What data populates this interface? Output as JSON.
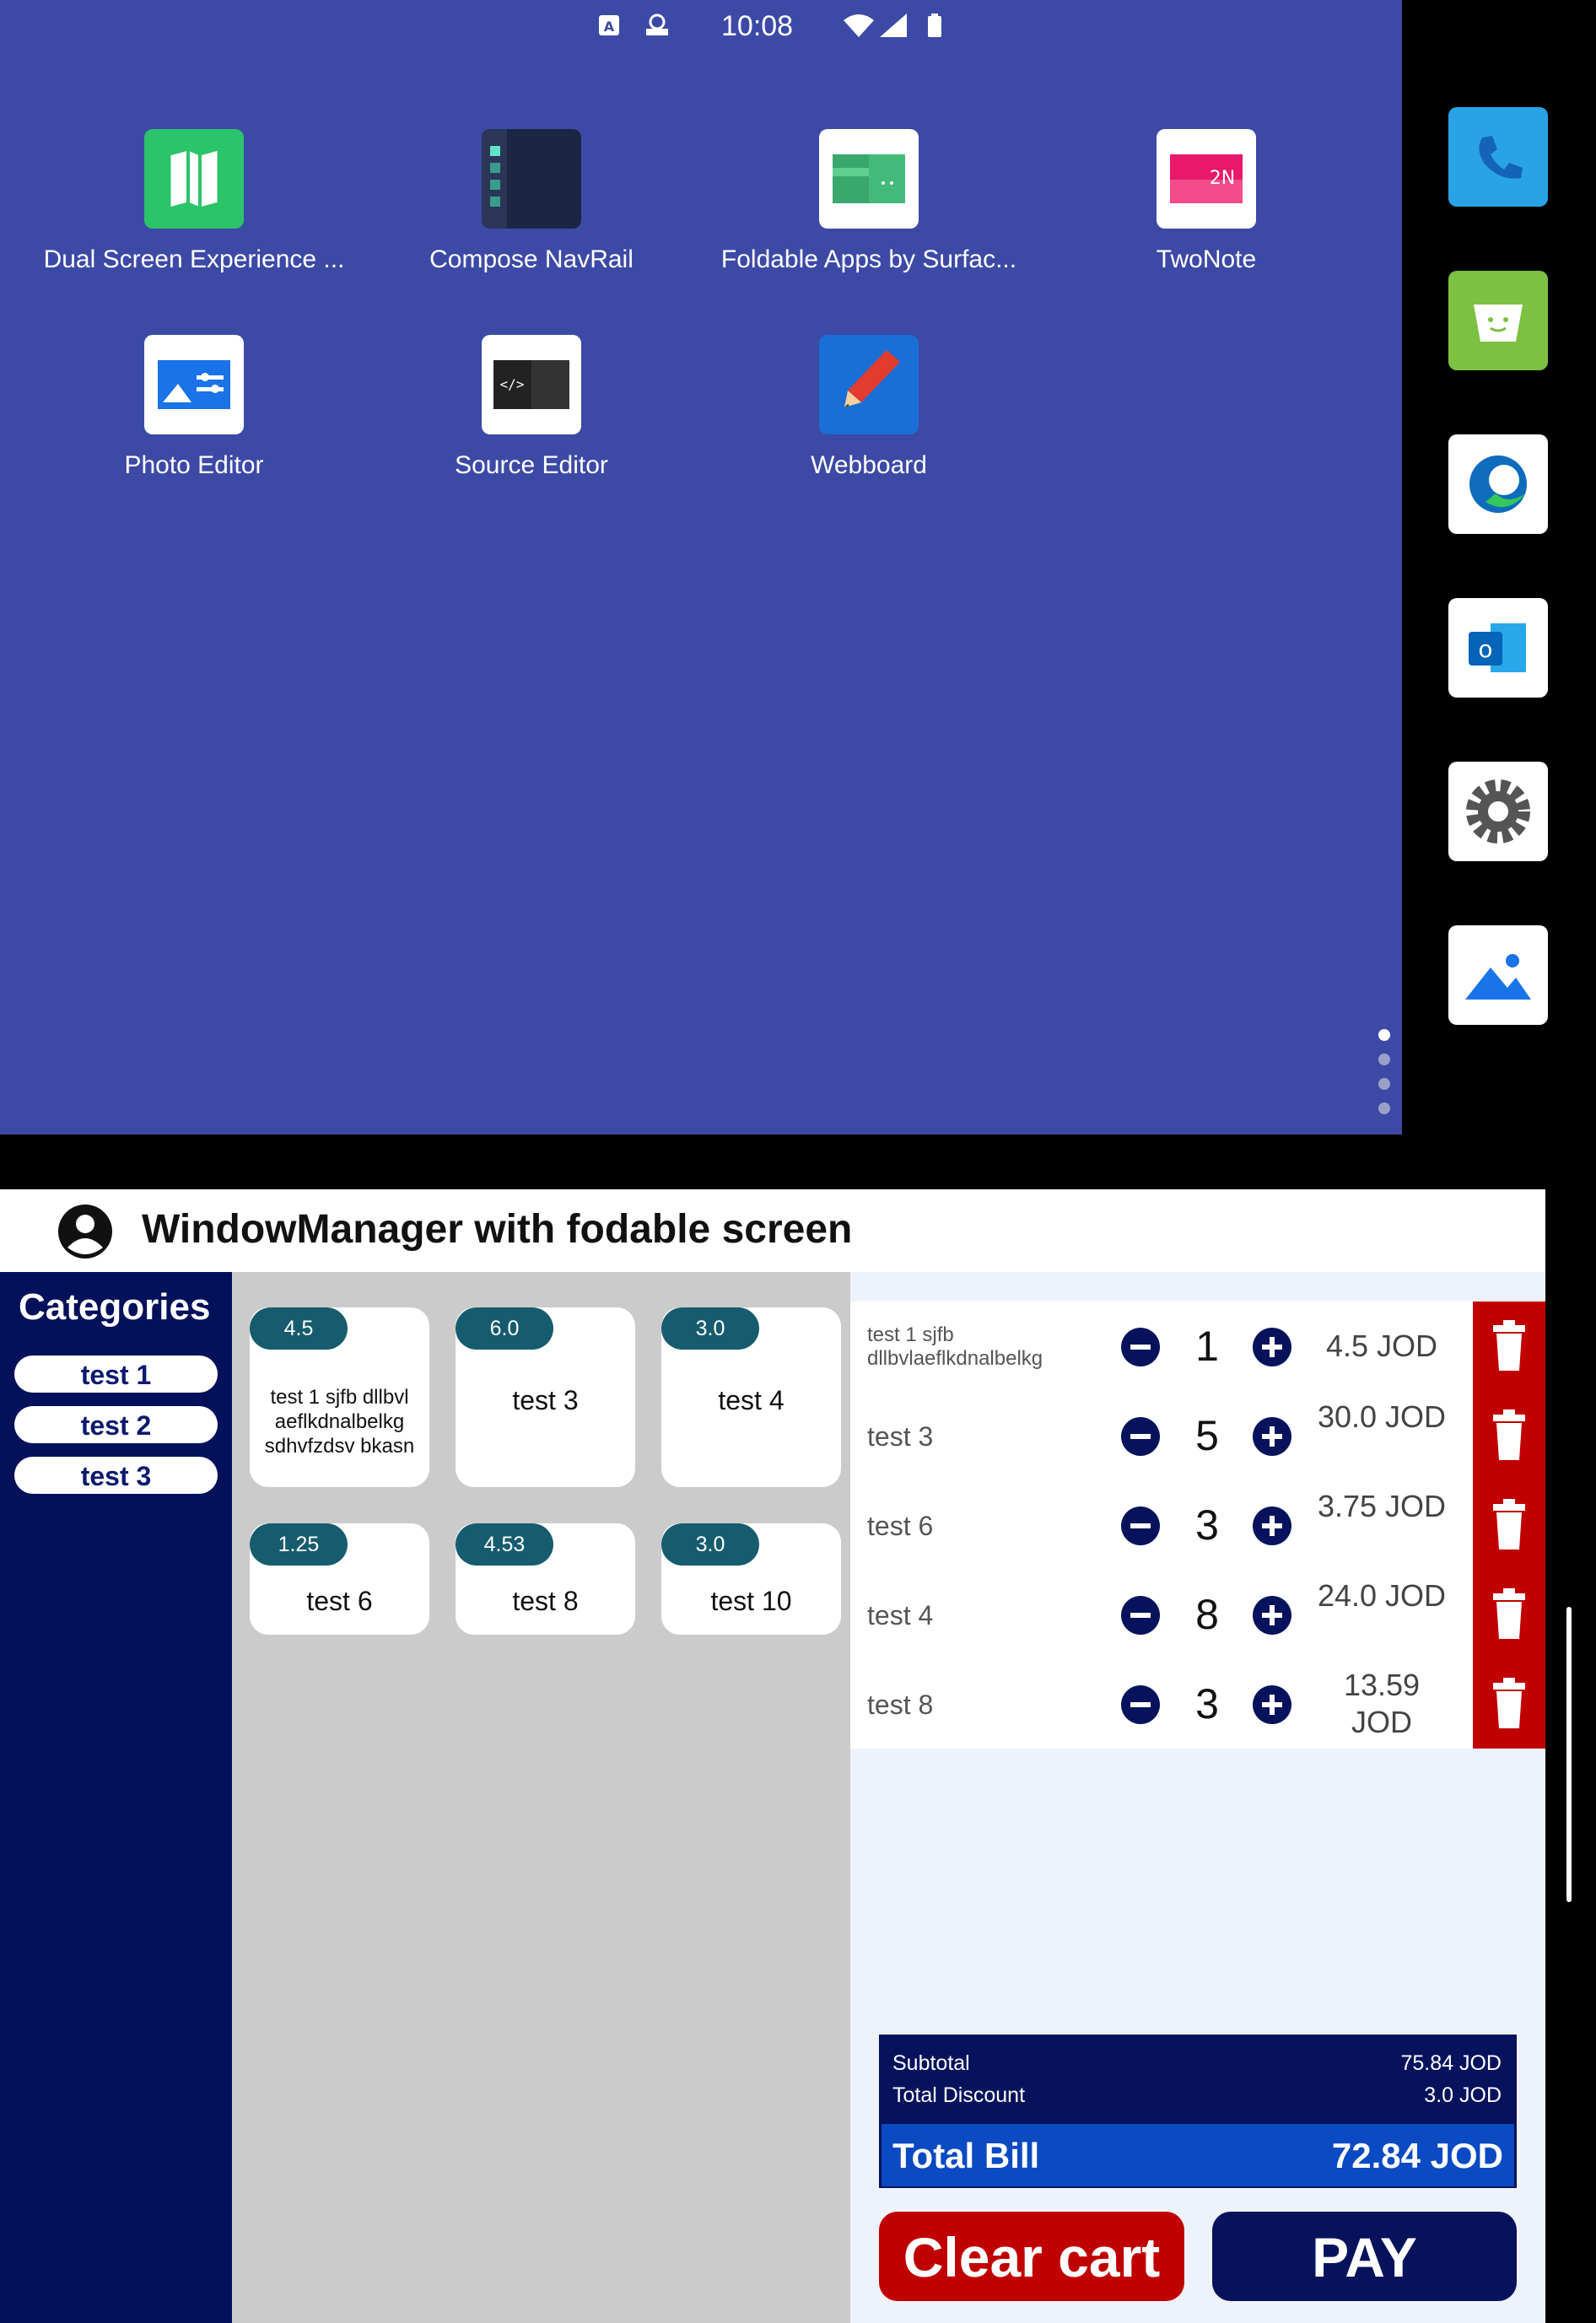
{
  "status_bar": {
    "time": "10:08"
  },
  "launcher": {
    "apps": [
      {
        "label": "Dual Screen Experience ...",
        "icon": "map-icon"
      },
      {
        "label": "Compose NavRail",
        "icon": "navrail-icon"
      },
      {
        "label": "Foldable Apps by Surfac...",
        "icon": "foldable-apps-icon"
      },
      {
        "label": "TwoNote",
        "icon": "twonote-icon",
        "badge": "2N"
      },
      {
        "label": "Photo Editor",
        "icon": "photo-editor-icon"
      },
      {
        "label": "Source Editor",
        "icon": "source-editor-icon",
        "badge": "</>"
      },
      {
        "label": "Webboard",
        "icon": "pencil-icon"
      }
    ],
    "dock": [
      "phone-icon",
      "messages-icon",
      "edge-icon",
      "outlook-icon",
      "settings-icon",
      "gallery-icon"
    ]
  },
  "app": {
    "title": "WindowManager with fodable screen",
    "categories_title": "Categories",
    "categories": [
      "test 1",
      "test 2",
      "test 3"
    ],
    "products": [
      {
        "price": "4.5",
        "name": "test 1 sjfb dllbvl aeflkdnalbelkg sdhvfzdsv bkasn"
      },
      {
        "price": "6.0",
        "name": "test 3"
      },
      {
        "price": "3.0",
        "name": "test 4"
      },
      {
        "price": "1.25",
        "name": "test 6"
      },
      {
        "price": "4.53",
        "name": "test 8"
      },
      {
        "price": "3.0",
        "name": "test 10"
      }
    ],
    "cart": [
      {
        "name": "test 1 sjfb dllbvlaeflkdnalbelkg",
        "qty": "1",
        "price": "4.5 JOD"
      },
      {
        "name": "test 3",
        "qty": "5",
        "price": "30.0 JOD"
      },
      {
        "name": "test 6",
        "qty": "3",
        "price": "3.75 JOD"
      },
      {
        "name": "test 4",
        "qty": "8",
        "price": "24.0 JOD"
      },
      {
        "name": "test 8",
        "qty": "3",
        "price": "13.59 JOD"
      }
    ],
    "summary": {
      "subtotal_label": "Subtotal",
      "subtotal_value": "75.84 JOD",
      "discount_label": "Total Discount",
      "discount_value": "3.0 JOD",
      "total_label": "Total Bill",
      "total_value": "72.84 JOD"
    },
    "buttons": {
      "clear": "Clear cart",
      "pay": "PAY"
    },
    "colors": {
      "navy": "#06135c",
      "red": "#c00000",
      "blue": "#0a4ac2",
      "teal": "#165c6e",
      "launcher_bg": "#3c4aa6"
    }
  }
}
